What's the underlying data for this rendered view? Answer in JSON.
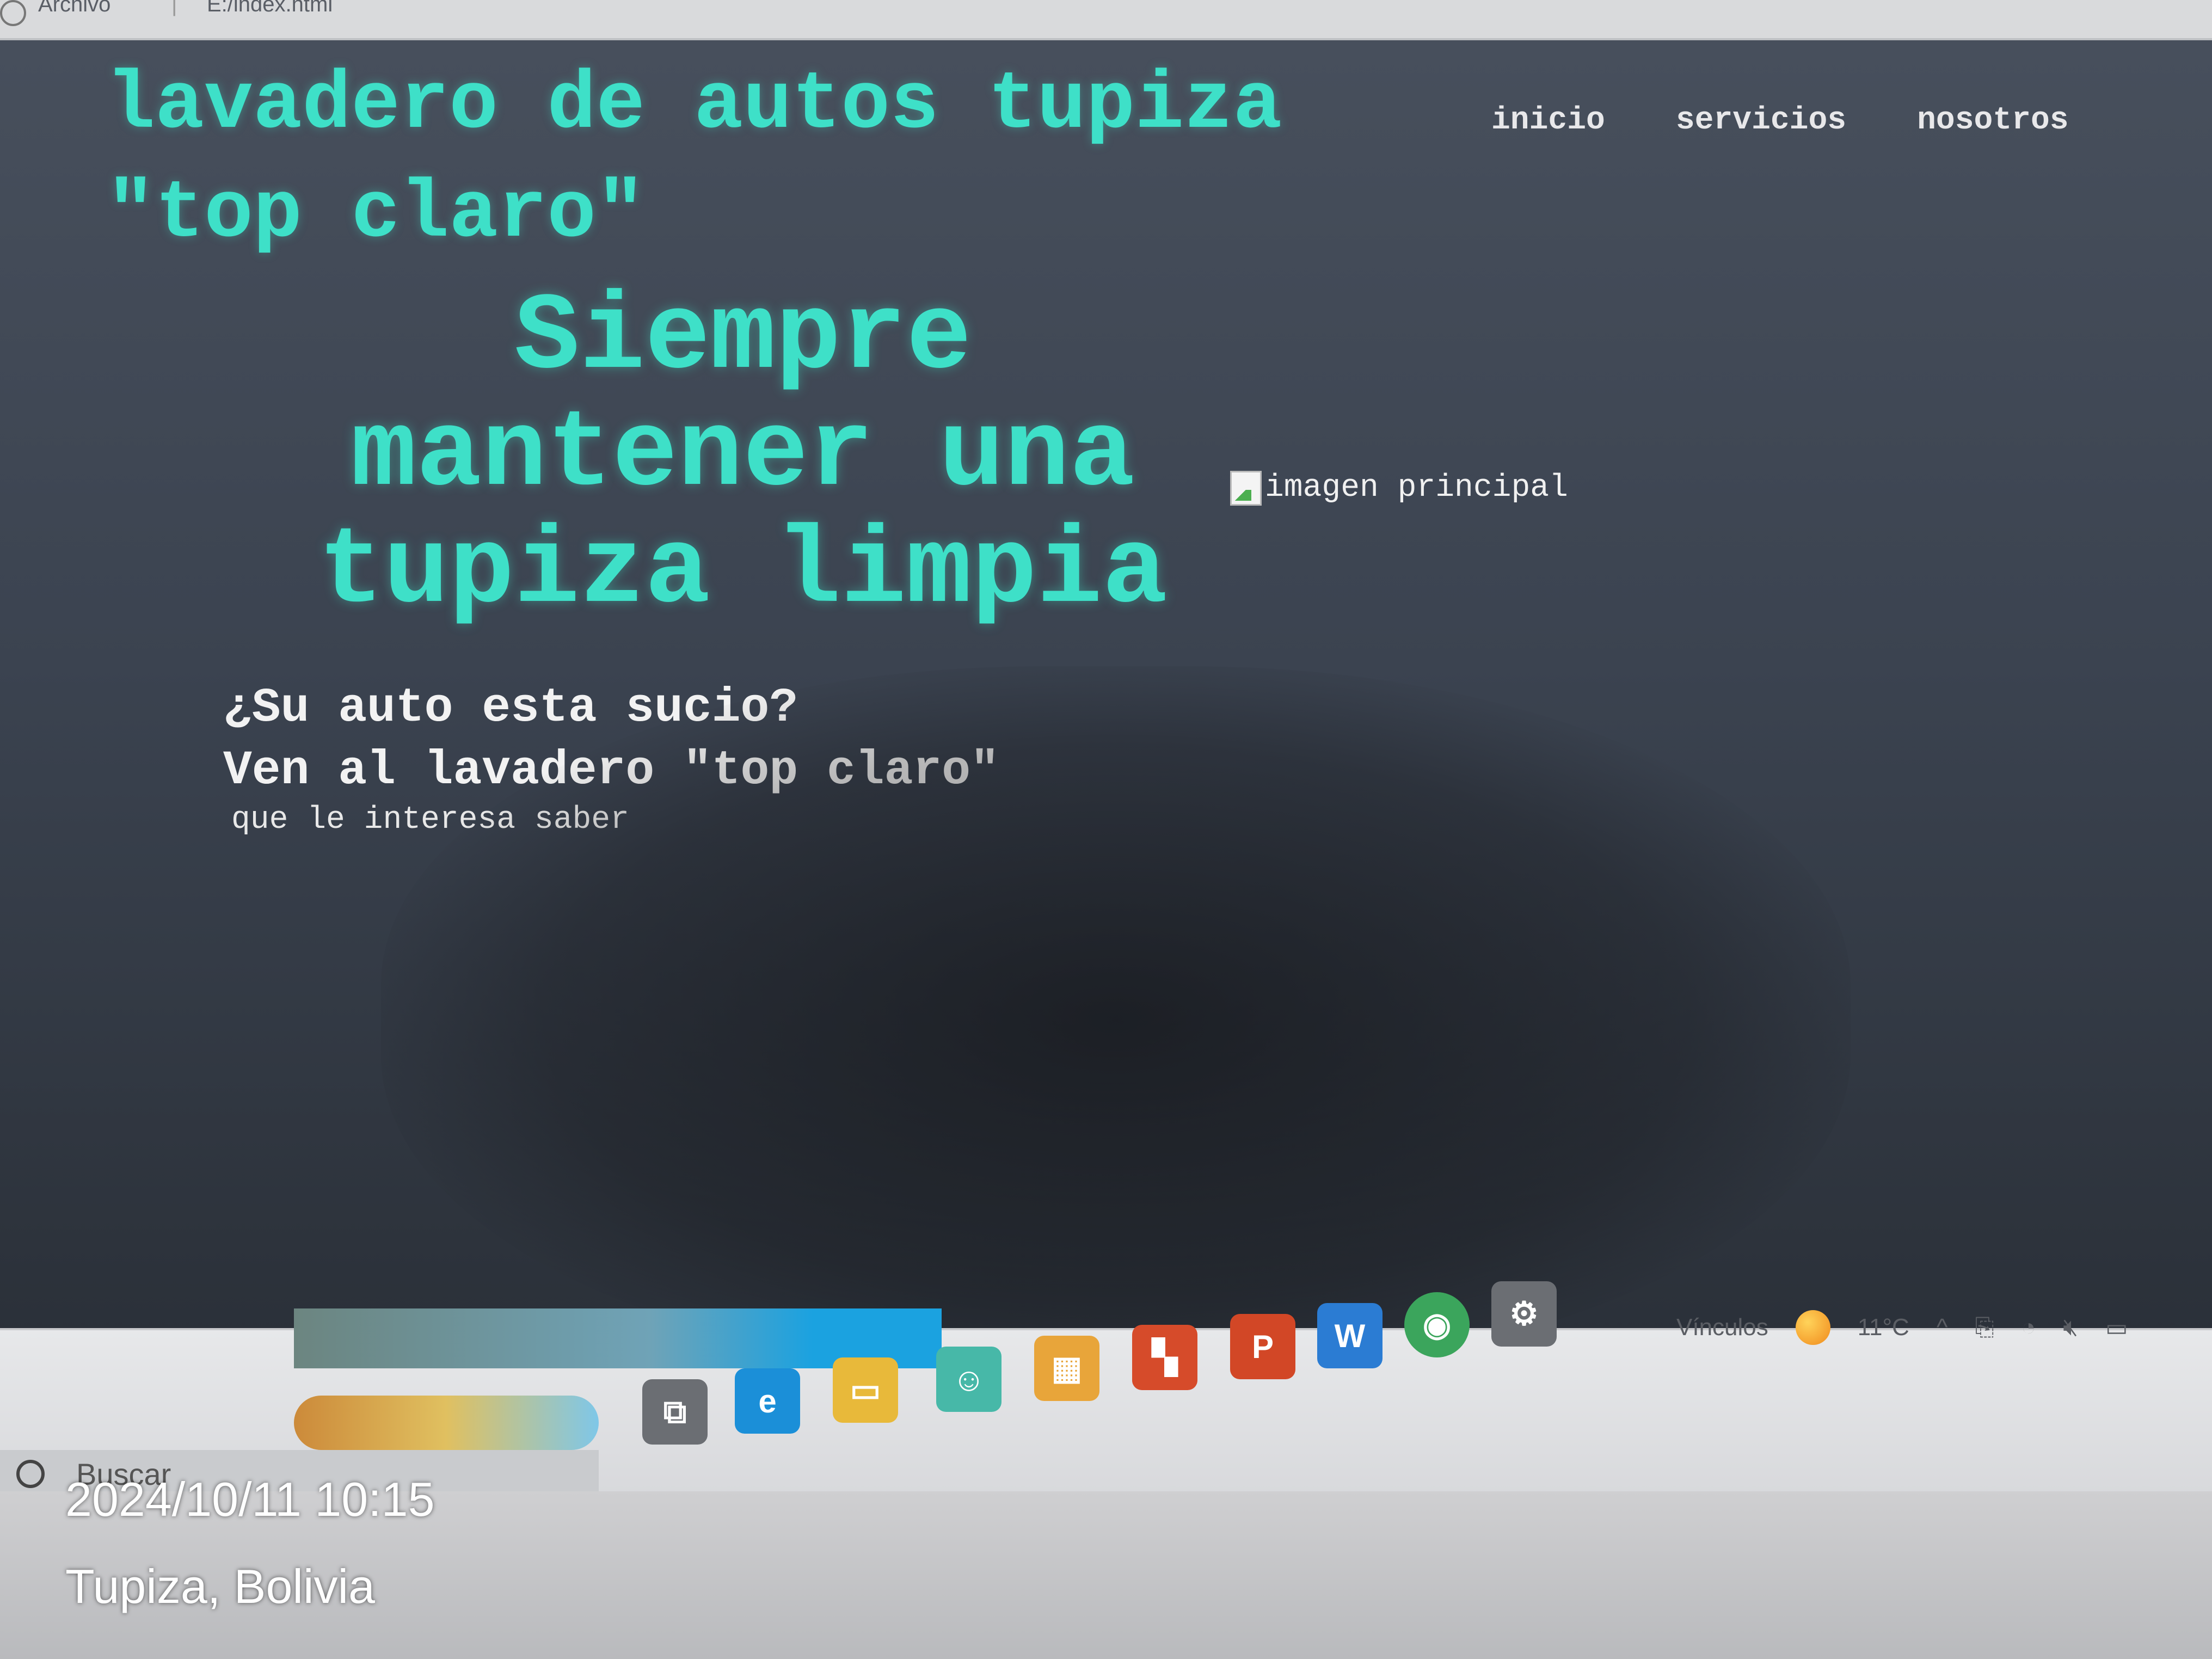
{
  "browser": {
    "file_label": "Archivo",
    "separator": "|",
    "path": "E:/index.html"
  },
  "site": {
    "title": "lavadero de autos tupiza \"top claro\"",
    "nav": [
      "inicio",
      "servicios",
      "nosotros"
    ],
    "hero_heading": "Siempre mantener una tupiza limpia",
    "hero_sub_line1": "¿Su auto esta sucio?",
    "hero_sub_line2": "Ven al lavadero \"top claro\"",
    "hero_small": "que le interesa saber",
    "main_image_alt": "imagen principal"
  },
  "taskbar": {
    "search_placeholder": "Buscar",
    "links_label": "Vínculos",
    "temperature": "11°C",
    "apps": [
      {
        "name": "task-view-icon",
        "color": "#6b6e73"
      },
      {
        "name": "edge-icon",
        "color": "#1b8fd8"
      },
      {
        "name": "file-explorer-icon",
        "color": "#e8b93a"
      },
      {
        "name": "teams-icon",
        "color": "#47b8a8"
      },
      {
        "name": "store-icon",
        "color": "#e8a53a"
      },
      {
        "name": "office-icon",
        "color": "#d64b2a"
      },
      {
        "name": "powerpoint-icon",
        "color": "#d24726"
      },
      {
        "name": "word-icon",
        "color": "#2b7cd3"
      },
      {
        "name": "chrome-icon",
        "color": "#3ba55c"
      },
      {
        "name": "settings-icon",
        "color": "#6b6e73"
      }
    ]
  },
  "photo_stamp": {
    "datetime": "2024/10/11 10:15",
    "location": "Tupiza, Bolivia"
  },
  "colors": {
    "accent": "#3ee0c8",
    "page_bg": "#3b4350",
    "nav_text": "#e8e8ea"
  }
}
